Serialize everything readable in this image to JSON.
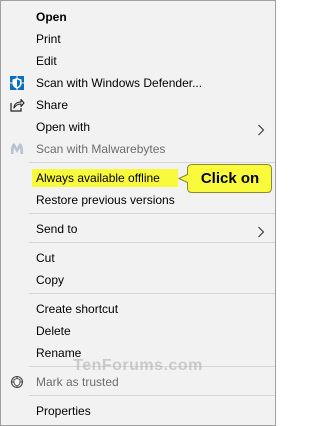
{
  "menu": {
    "open": "Open",
    "print": "Print",
    "edit": "Edit",
    "scan_defender": "Scan with Windows Defender...",
    "share": "Share",
    "open_with": "Open with",
    "scan_malwarebytes": "Scan with Malwarebytes",
    "always_offline": "Always available offline",
    "restore_versions": "Restore previous versions",
    "send_to": "Send to",
    "cut": "Cut",
    "copy": "Copy",
    "create_shortcut": "Create shortcut",
    "delete": "Delete",
    "rename": "Rename",
    "mark_trusted": "Mark as trusted",
    "properties": "Properties"
  },
  "callout": {
    "text": "Click on"
  },
  "watermark": "TenForums.com",
  "icons": {
    "defender": "shield-icon",
    "share": "share-icon",
    "malwarebytes": "malwarebytes-icon",
    "mark_trusted": "trust-shield-icon",
    "submenu": "chevron-right-icon"
  },
  "colors": {
    "menu_bg": "#f2f2f2",
    "highlight": "#fafa3c",
    "disabled_text": "#6d6d6d",
    "defender_blue": "#0a6fc2"
  }
}
